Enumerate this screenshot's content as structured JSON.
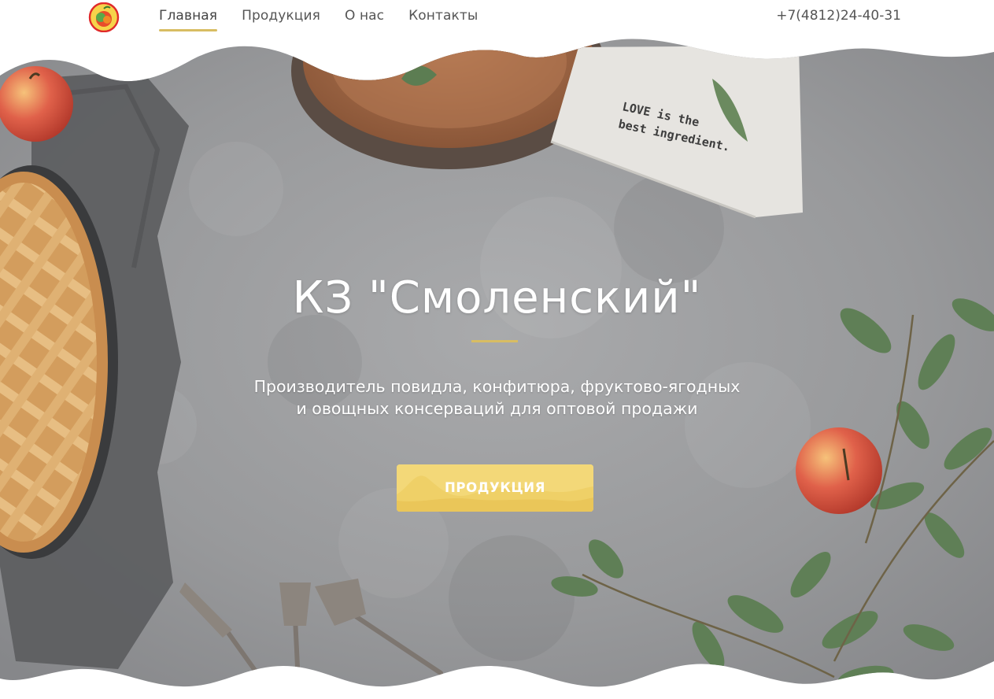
{
  "header": {
    "logo_icon": "fruit-jam-logo-icon",
    "nav": [
      {
        "label": "Главная",
        "active": true
      },
      {
        "label": "Продукция",
        "active": false
      },
      {
        "label": "О нас",
        "active": false
      },
      {
        "label": "Контакты",
        "active": false
      }
    ],
    "phone": "+7(4812)24-40-31"
  },
  "hero": {
    "title": "КЗ \"Смоленский\"",
    "subtitle_line1": "Производитель повидла, конфитюра, фруктово-ягодных",
    "subtitle_line2": "и овощных консерваций для оптовой продажи",
    "cta_label": "ПРОДУКЦИЯ",
    "napkin_text_line1": "LOVE is the",
    "napkin_text_line2": "best ingredient."
  },
  "colors": {
    "accent": "#d8bd63",
    "cta": "#f3d878",
    "nav_text": "#555555",
    "background_stone": "#9a9b9d"
  }
}
